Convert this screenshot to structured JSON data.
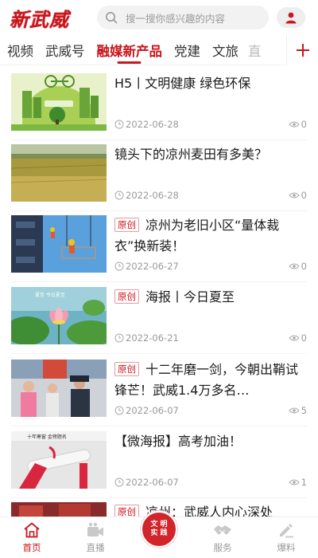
{
  "header": {
    "logo_text": "新武威",
    "search_placeholder": "搜一搜你感兴趣的内容"
  },
  "tabs": [
    {
      "label": "视频"
    },
    {
      "label": "武威号"
    },
    {
      "label": "融媒新产品",
      "active": true
    },
    {
      "label": "党建"
    },
    {
      "label": "文旅"
    },
    {
      "label": "直"
    }
  ],
  "feed": [
    {
      "title": "H5丨文明健康 绿色环保",
      "badge": "",
      "date": "2022-06-28",
      "views": "0",
      "thumb": "green-city-illustration"
    },
    {
      "title": "镜头下的凉州麦田有多美？",
      "badge": "",
      "date": "2022-06-28",
      "views": "0",
      "thumb": "wheat-field"
    },
    {
      "title": "凉州为老旧小区“量体裁衣”换新装！",
      "badge": "原创",
      "date": "2022-06-27",
      "views": "0",
      "thumb": "building-workers"
    },
    {
      "title": "海报丨今日夏至",
      "badge": "原创",
      "date": "2022-06-21",
      "views": "0",
      "thumb": "lotus-poster"
    },
    {
      "title": "十二年磨一剑，今朝出鞘试锋芒！武威1.4万多名…",
      "badge": "原创",
      "date": "2022-06-07",
      "views": "5",
      "thumb": "exam-students"
    },
    {
      "title": "【微海报】高考加油！",
      "badge": "",
      "date": "2022-06-07",
      "views": "1",
      "thumb": "exam-poster"
    },
    {
      "title": "凉州：武威人内心深处",
      "badge": "原创",
      "date": "",
      "views": "",
      "thumb": "partial"
    }
  ],
  "thumb_texts": {
    "lotus_caption": "夏至 今日夏至",
    "exam_poster_caption": "十年寒窗 金榜题名"
  },
  "bottom_nav": {
    "home": "首页",
    "live": "直播",
    "center_top": "文明",
    "center_bottom": "实践",
    "service": "服务",
    "report": "爆料"
  },
  "colors": {
    "brand_red": "#c8161d",
    "muted_text": "#999999"
  }
}
